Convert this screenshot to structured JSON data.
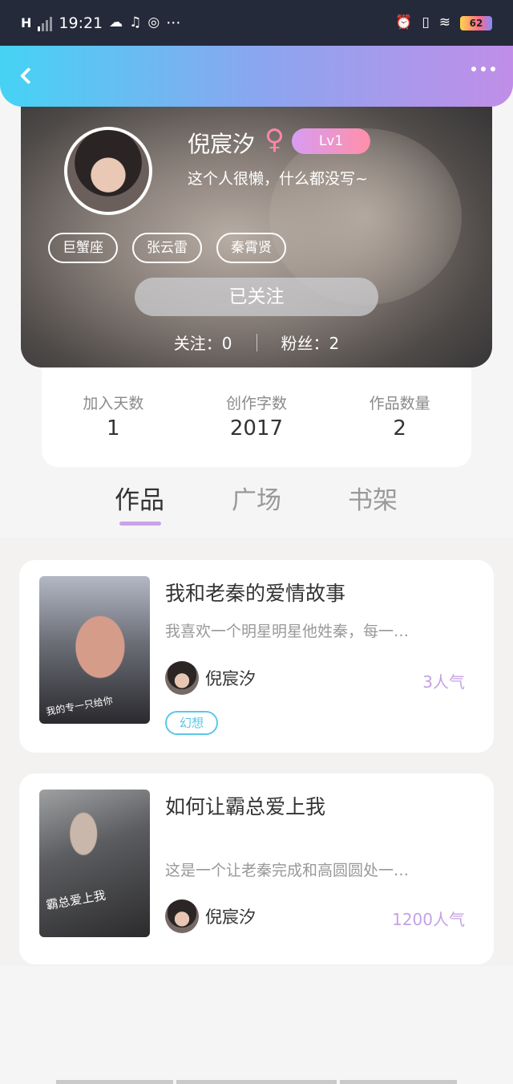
{
  "status_bar": {
    "network": "H",
    "time": "19:21",
    "more": "···",
    "battery": "62"
  },
  "header": {
    "back_icon": "chevron-left-icon",
    "more_icon": "more-dots-icon"
  },
  "profile": {
    "name": "倪宸汐",
    "gender_symbol": "♀",
    "level": "Lv1",
    "bio": "这个人很懒，什么都没写~",
    "tags": [
      "巨蟹座",
      "张云雷",
      "秦霄贤"
    ],
    "follow_button": "已关注",
    "following": "关注：0",
    "fans": "粉丝：2"
  },
  "stats": [
    {
      "label": "加入天数",
      "value": "1"
    },
    {
      "label": "创作字数",
      "value": "2017"
    },
    {
      "label": "作品数量",
      "value": "2"
    }
  ],
  "tabs": [
    "作品",
    "广场",
    "书架"
  ],
  "active_tab": 0,
  "works": [
    {
      "title": "我和老秦的爱情故事",
      "desc": "我喜欢一个明星明星他姓秦，每一…",
      "author": "倪宸汐",
      "popularity": "3人气",
      "genre": "幻想",
      "cover_text": "我的专一只给你"
    },
    {
      "title": "如何让霸总爱上我",
      "desc": "这是一个让老秦完成和高圆圆处一…",
      "author": "倪宸汐",
      "popularity": "1200人气",
      "cover_text": "霸总爱上我"
    }
  ],
  "colors": {
    "header_gradient_start": "#45d3f4",
    "header_gradient_end": "#c18ee8",
    "accent_purple": "#c4a2e4",
    "genre_blue": "#5cc7e6"
  }
}
